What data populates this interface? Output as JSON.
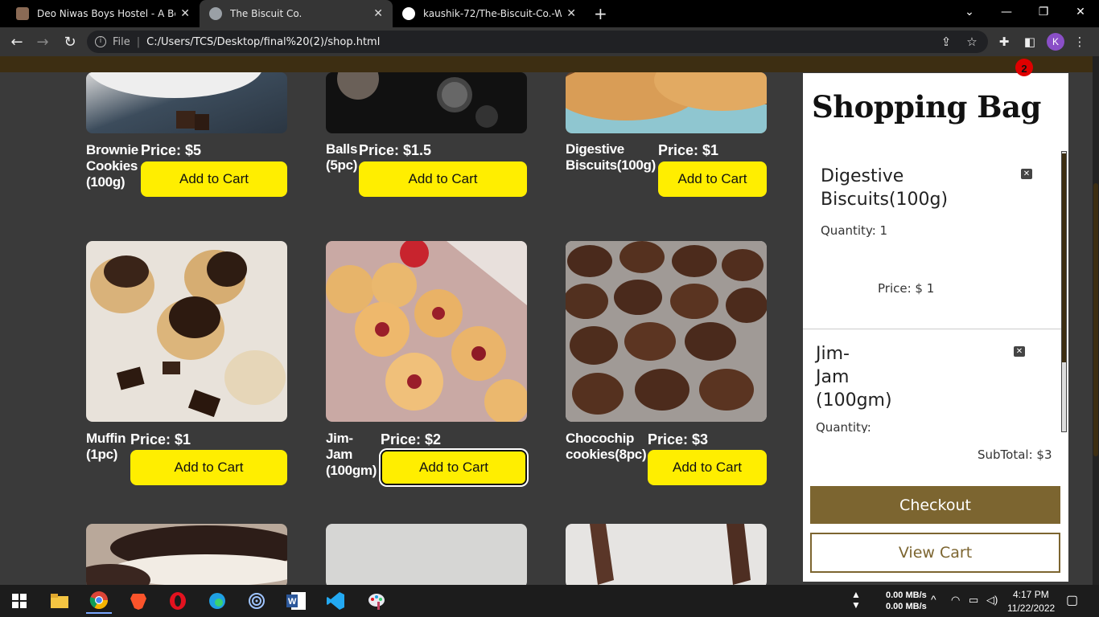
{
  "browser": {
    "tabs": [
      {
        "title": "Deo Niwas Boys Hostel - A Best F",
        "active": false
      },
      {
        "title": "The Biscuit Co.",
        "active": true
      },
      {
        "title": "kaushik-72/The-Biscuit-Co.-Webs",
        "active": false
      }
    ],
    "new_tab": "+",
    "address": {
      "scheme": "File",
      "url": "C:/Users/TCS/Desktop/final%20(2)/shop.html"
    },
    "profile_initial": "K"
  },
  "cart_badge": "2",
  "products": [
    {
      "name_lines": [
        "Brownie",
        "Cookies",
        "(100g)"
      ],
      "price": "Price: $5",
      "button": "Add to Cart"
    },
    {
      "name_lines": [
        "Balls",
        "(5pc)"
      ],
      "price": "Price: $1.5",
      "button": "Add to Cart"
    },
    {
      "name_lines": [
        "Digestive",
        "Biscuits(100g)"
      ],
      "price": "Price: $1",
      "button": "Add to Cart"
    },
    {
      "name_lines": [
        "Muffin",
        "(1pc)"
      ],
      "price": "Price: $1",
      "button": "Add to Cart"
    },
    {
      "name_lines": [
        "Jim-",
        "Jam",
        "(100gm)"
      ],
      "price": "Price: $2",
      "button": "Add to Cart"
    },
    {
      "name_lines": [
        "Chocochip",
        "cookies(8pc)"
      ],
      "price": "Price: $3",
      "button": "Add to Cart"
    }
  ],
  "bag": {
    "title": "Shopping Bag",
    "items": [
      {
        "name_lines": [
          "Digestive",
          "Biscuits(100g)"
        ],
        "quantity": "Quantity: 1",
        "price": "Price: $ 1"
      },
      {
        "name_lines": [
          "Jim-",
          "Jam",
          "(100gm)"
        ],
        "quantity": "Quantity:",
        "price": ""
      }
    ],
    "subtotal": "SubTotal: $3",
    "checkout": "Checkout",
    "view_cart": "View Cart"
  },
  "taskbar": {
    "net_up": "0.00 MB/s",
    "net_down": "0.00 MB/s",
    "time": "4:17 PM",
    "date": "11/22/2022"
  }
}
